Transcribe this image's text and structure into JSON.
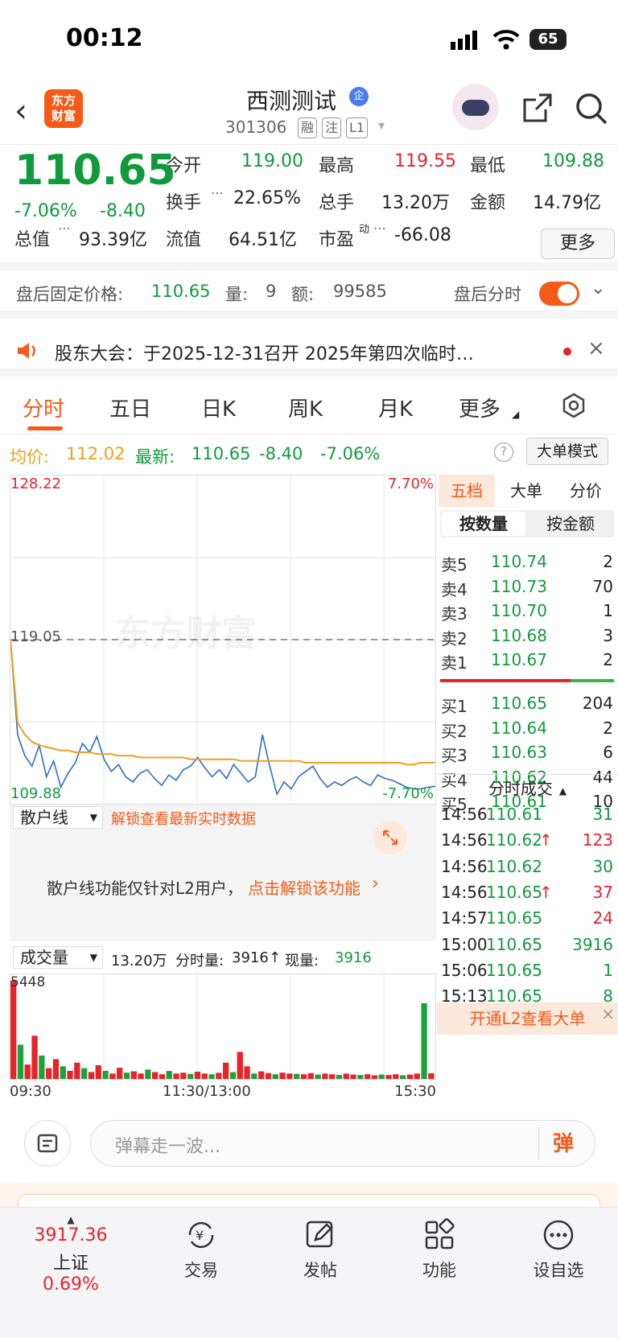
{
  "status": {
    "time": "00:12",
    "battery": "65"
  },
  "header": {
    "stock_name": "西测测试",
    "badge": "企",
    "code": "301306",
    "tags": [
      "融",
      "注",
      "L1"
    ]
  },
  "quote": {
    "price": "110.65",
    "change_pct": "-7.06%",
    "change": "-8.40",
    "open_label": "今开",
    "open": "119.00",
    "high_label": "最高",
    "high": "119.55",
    "low_label": "最低",
    "low": "109.88",
    "turnover_label": "换手",
    "turnover": "22.65%",
    "vol_label": "总手",
    "vol": "13.20万",
    "amount_label": "金额",
    "amount": "14.79亿",
    "mcap_label": "总值",
    "mcap": "93.39亿",
    "float_label": "流值",
    "float": "64.51亿",
    "pe_label": "市盈",
    "pe_sup": "动",
    "pe": "-66.08",
    "more": "更多"
  },
  "after_hours": {
    "label": "盘后固定价格:",
    "price": "110.65",
    "vol_label": "量:",
    "vol": "9",
    "amt_label": "额:",
    "amt": "99585",
    "time_label": "盘后分时"
  },
  "notice": {
    "text": "股东大会：于2025-12-31召开 2025年第四次临时…"
  },
  "tabs": [
    "分时",
    "五日",
    "日K",
    "周K",
    "月K",
    "更多"
  ],
  "avg_bar": {
    "avg_label": "均价:",
    "avg": "112.02",
    "latest_label": "最新:",
    "latest": "110.65",
    "chg": "-8.40",
    "pct": "-7.06%",
    "mode_btn": "大单模式"
  },
  "chart_data": {
    "type": "line",
    "ylim": [
      109.88,
      128.22
    ],
    "ref_price": "119.05",
    "labels": {
      "top": "128.22",
      "bottom": "109.88",
      "top_pct": "7.70%",
      "bottom_pct": "-7.70%",
      "ref": "119.05",
      "watermark": "东方财富"
    },
    "series": [
      {
        "values": [
          119.05,
          113.6,
          112.4,
          111.8,
          113.0,
          111.2,
          112.1,
          110.6,
          111.4,
          112.0,
          113.1,
          112.6,
          113.5,
          112.2,
          111.5,
          111.9,
          111.2,
          110.9,
          111.4,
          111.6,
          111.1,
          110.7,
          111.3,
          111.0,
          111.6,
          111.8,
          112.3,
          111.7,
          111.2,
          111.6,
          111.1,
          111.9,
          111.4,
          110.9,
          111.2,
          113.6,
          111.8,
          110.2,
          110.9,
          110.5,
          111.2,
          111.5,
          111.8,
          111.1,
          110.6,
          110.9,
          110.7,
          111.0,
          111.2,
          110.9,
          110.7,
          111.3,
          111.1,
          111.0,
          110.8,
          110.6,
          110.5,
          110.5,
          110.6,
          110.65
        ]
      },
      {
        "values": [
          119.05,
          114.3,
          113.6,
          113.2,
          113.0,
          112.9,
          112.8,
          112.7,
          112.7,
          112.6,
          112.6,
          112.6,
          112.5,
          112.5,
          112.5,
          112.4,
          112.4,
          112.4,
          112.3,
          112.3,
          112.3,
          112.3,
          112.3,
          112.3,
          112.3,
          112.2,
          112.2,
          112.2,
          112.2,
          112.2,
          112.2,
          112.2,
          112.1,
          112.1,
          112.1,
          112.1,
          112.1,
          112.1,
          112.1,
          112.1,
          112.1,
          112.0,
          112.0,
          112.0,
          112.0,
          112.0,
          112.0,
          112.0,
          112.0,
          112.0,
          112.0,
          112.0,
          112.0,
          112.0,
          112.0,
          111.9,
          111.9,
          112.0,
          112.0,
          112.02
        ]
      }
    ],
    "volume": {
      "max_label": "5448",
      "values": [
        5448,
        1900,
        800,
        2400,
        1300,
        600,
        1100,
        700,
        450,
        900,
        600,
        380,
        760,
        450,
        300,
        620,
        350,
        420,
        300,
        520,
        380,
        260,
        440,
        300,
        350,
        280,
        400,
        300,
        260,
        340,
        900,
        380,
        1500,
        700,
        300,
        420,
        320,
        260,
        350,
        300,
        280,
        260,
        320,
        240,
        300,
        260,
        220,
        300,
        240,
        220,
        260,
        200,
        240,
        220,
        260,
        200,
        240,
        300,
        4200,
        320
      ]
    },
    "time_axis": [
      "09:30",
      "11:30/13:00",
      "15:30"
    ]
  },
  "sanhu": {
    "dropdown": "散户线",
    "unlock": "解锁查看最新实时数据",
    "msg": "散户线功能仅针对L2用户，",
    "link": "点击解锁该功能"
  },
  "volbar": {
    "dropdown": "成交量",
    "total": "13.20万",
    "fs_label": "分时量:",
    "fs": "3916",
    "cur_label": "现量:",
    "cur": "3916"
  },
  "orderbook": {
    "tabs": [
      "五档",
      "大单",
      "分价"
    ],
    "sub": [
      "按数量",
      "按金额"
    ],
    "asks": [
      [
        "卖5",
        "110.74",
        "2"
      ],
      [
        "卖4",
        "110.73",
        "70"
      ],
      [
        "卖3",
        "110.70",
        "1"
      ],
      [
        "卖2",
        "110.68",
        "3"
      ],
      [
        "卖1",
        "110.67",
        "2"
      ]
    ],
    "bids": [
      [
        "买1",
        "110.65",
        "204"
      ],
      [
        "买2",
        "110.64",
        "2"
      ],
      [
        "买3",
        "110.63",
        "6"
      ],
      [
        "买4",
        "110.62",
        "44"
      ],
      [
        "买5",
        "110.61",
        "10"
      ]
    ],
    "trades_title": "分时成交",
    "trades": [
      [
        "14:56",
        "110.61",
        "",
        "31"
      ],
      [
        "14:56",
        "110.62",
        "↑",
        "123"
      ],
      [
        "14:56",
        "110.62",
        "",
        "30"
      ],
      [
        "14:56",
        "110.65",
        "↑",
        "37"
      ],
      [
        "14:57",
        "110.65",
        "",
        "24"
      ],
      [
        "15:00",
        "110.65",
        "",
        "3916"
      ],
      [
        "15:06",
        "110.65",
        "",
        "1"
      ],
      [
        "15:13",
        "110.65",
        "",
        "8"
      ]
    ],
    "l2": "开通L2查看大单"
  },
  "comment": {
    "placeholder": "弹幕走一波...",
    "btn": "弹"
  },
  "nav": {
    "index_val": "3917.36",
    "index_name": "上证",
    "index_pct": "0.69%",
    "items": [
      "交易",
      "发帖",
      "功能",
      "设自选"
    ]
  }
}
